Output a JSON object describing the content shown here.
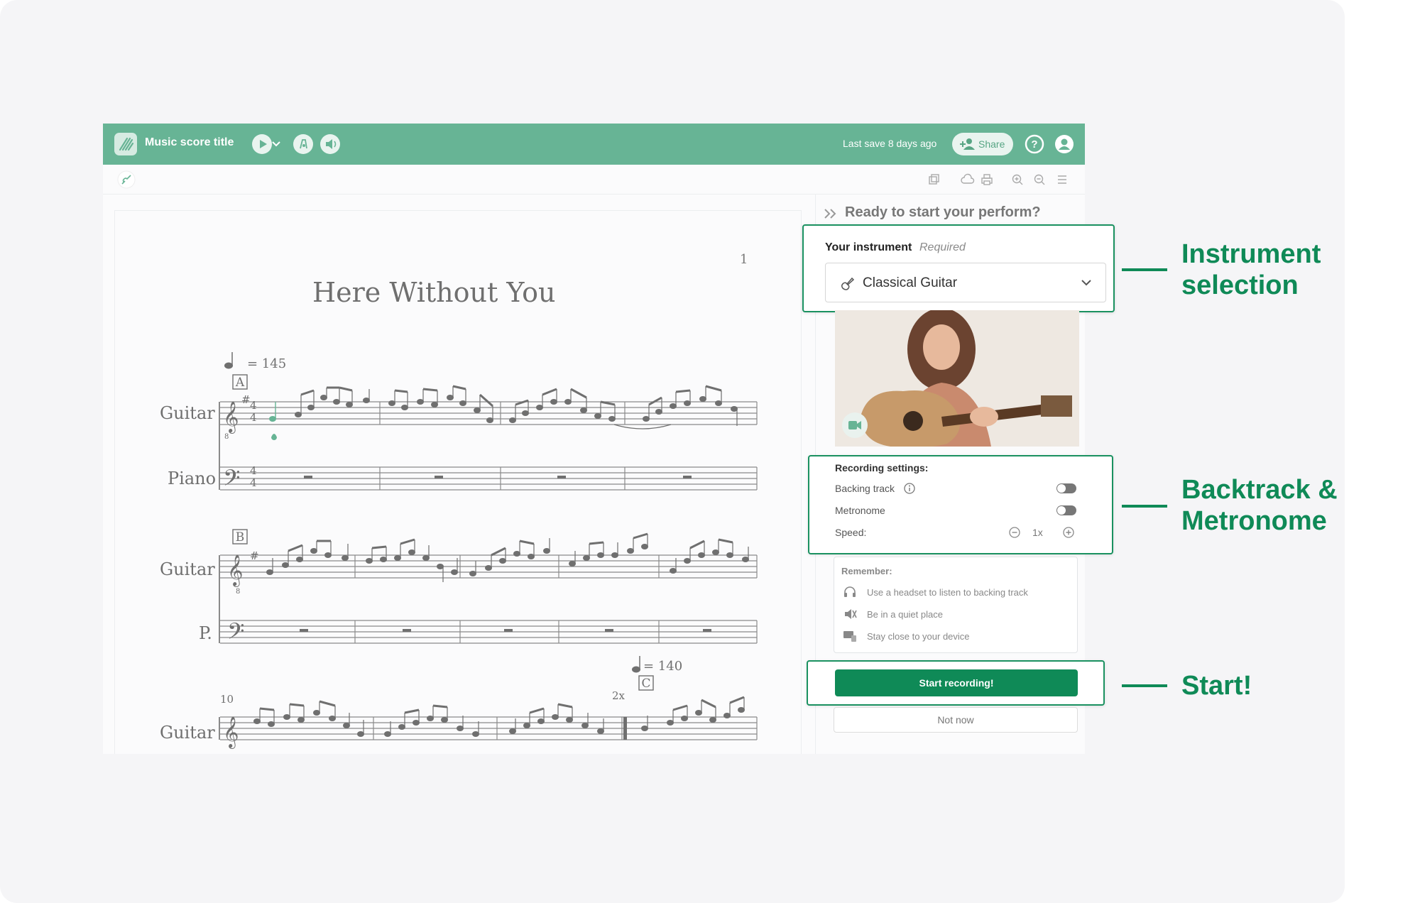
{
  "header": {
    "title": "Music score title",
    "last_save": "Last save 8 days ago",
    "share_label": "Share"
  },
  "score": {
    "page_number": "1",
    "title": "Here Without You",
    "tempo_1": "= 145",
    "tempo_2": "= 140",
    "rehearsal_a": "A",
    "rehearsal_b": "B",
    "rehearsal_c": "C",
    "repeat_count": "2x",
    "measure_number": "10",
    "staff_guitar": "Guitar",
    "staff_piano": "Piano",
    "staff_piano_short": "P.",
    "time_sig_top": "4",
    "time_sig_bottom": "4",
    "octave_mark": "8"
  },
  "panel": {
    "ready_text": "Ready to start your perform?",
    "instrument_label": "Your instrument",
    "instrument_required": "Required",
    "instrument_value": "Classical Guitar",
    "recording_title": "Recording settings:",
    "backing_track": "Backing track",
    "metronome": "Metronome",
    "speed_label": "Speed:",
    "speed_value": "1x",
    "remember_title": "Remember:",
    "remember_items": [
      "Use a headset to listen to backing track",
      "Be in a quiet place",
      "Stay close to your device"
    ],
    "start_button": "Start recording!",
    "not_now": "Not now"
  },
  "callouts": {
    "instrument_line1": "Instrument",
    "instrument_line2": "selection",
    "backtrack_line1": "Backtrack &",
    "backtrack_line2": "Metronome",
    "start": "Start!"
  },
  "settings_state": {
    "backing_track_on": false,
    "metronome_on": false
  },
  "colors": {
    "header_bg": "#67b495",
    "accent": "#0f8a57",
    "outline": "#1a9160"
  },
  "icons": [
    "logo-icon",
    "play-icon",
    "chevron-down-icon",
    "tuner-icon",
    "speaker-icon",
    "add-user-icon",
    "help-icon",
    "user-icon",
    "guitar-icon",
    "copy-icon",
    "cloud-icon",
    "print-icon",
    "zoom-in-icon",
    "zoom-out-icon",
    "menu-icon",
    "double-chevron-icon",
    "camera-icon",
    "info-icon",
    "minus-icon",
    "plus-icon",
    "headset-icon",
    "mute-icon",
    "device-icon"
  ]
}
